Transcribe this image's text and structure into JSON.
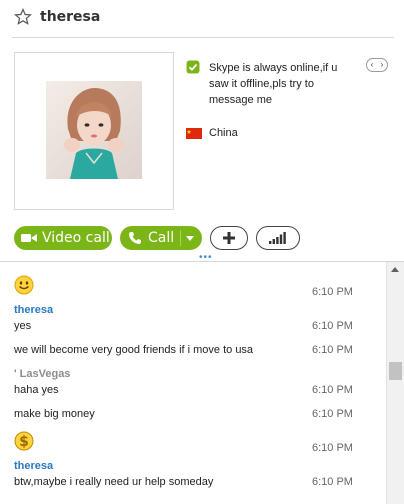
{
  "header": {
    "contact_name": "theresa"
  },
  "profile": {
    "mood_message": "Skype is always online,if u saw it offline,pls try to message me",
    "country": "China"
  },
  "actions": {
    "video_call_label": "Video call",
    "call_label": "Call"
  },
  "chat": {
    "messages": [
      {
        "emoticon": "smile-emoticon",
        "time": "6:10 PM"
      },
      {
        "sender": "theresa",
        "text": "yes",
        "time": "6:10 PM"
      },
      {
        "text": "we will become very good friends if i move to usa",
        "time": "6:10 PM"
      },
      {
        "sender": "' LasVegas",
        "text": "haha yes",
        "time": "6:10 PM"
      },
      {
        "text": "make big money",
        "time": "6:10 PM"
      },
      {
        "emoticon": "dollar-emoticon",
        "time": "6:10 PM"
      },
      {
        "sender": "theresa",
        "text": "btw,maybe i really need ur help someday",
        "time": "6:10 PM"
      }
    ]
  },
  "colors": {
    "accent_green": "#7cb518",
    "sender_blue": "#2a7ac2",
    "sender_gray": "#8c8c8c"
  }
}
